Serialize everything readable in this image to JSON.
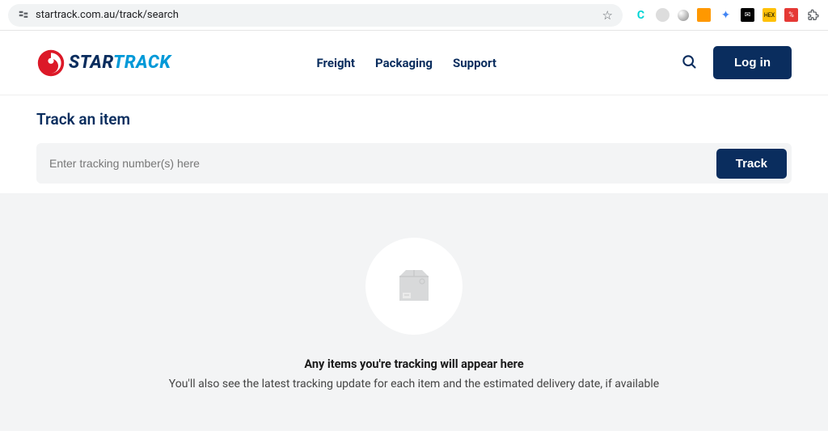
{
  "browser": {
    "url": "startrack.com.au/track/search"
  },
  "header": {
    "logo": {
      "star": "STAR",
      "track": "TRACK"
    },
    "nav": [
      "Freight",
      "Packaging",
      "Support"
    ],
    "login_label": "Log in"
  },
  "page": {
    "title": "Track an item",
    "input_placeholder": "Enter tracking number(s) here",
    "track_label": "Track"
  },
  "empty": {
    "heading": "Any items you're tracking will appear here",
    "sub": "You'll also see the latest tracking update for each item and the estimated delivery date, if available"
  }
}
